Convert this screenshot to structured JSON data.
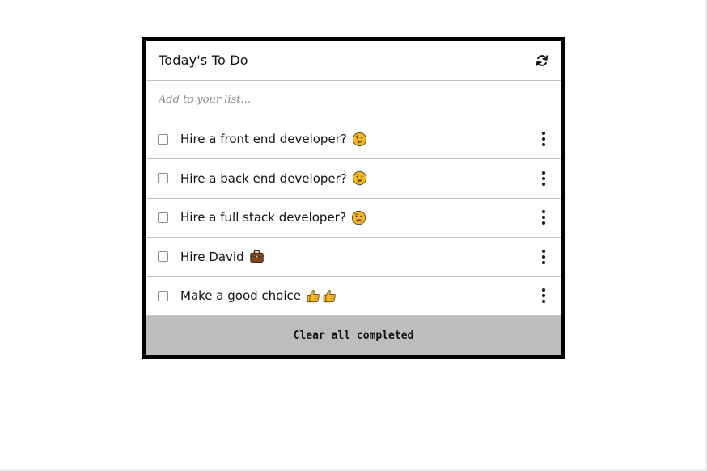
{
  "header": {
    "title": "Today's To Do",
    "refresh_icon": "refresh-icon"
  },
  "add_input": {
    "placeholder": "Add to your list..."
  },
  "items": [
    {
      "label": "Hire a front end developer?",
      "emoji": "thinking-face",
      "checked": false
    },
    {
      "label": "Hire a back end developer?",
      "emoji": "thinking-face",
      "checked": false
    },
    {
      "label": "Hire a full stack developer?",
      "emoji": "thinking-face",
      "checked": false
    },
    {
      "label": "Hire David",
      "emoji": "briefcase",
      "checked": false
    },
    {
      "label": "Make a good choice",
      "emoji": "thumbs-up-thumbs-up",
      "checked": false
    }
  ],
  "footer": {
    "clear_label": "Clear all completed"
  },
  "colors": {
    "border": "#000000",
    "divider": "#c4c4c4",
    "footer_bg": "#bdbdbd",
    "emoji_yellow": "#f5b823"
  }
}
